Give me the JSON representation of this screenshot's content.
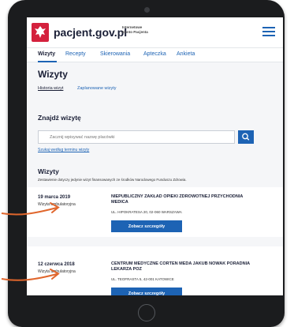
{
  "header": {
    "site_name": "pacjent.gov.pl",
    "sub_line1": "Internetowe",
    "sub_line2": "Konto Pacjenta"
  },
  "nav": {
    "tabs": [
      {
        "label": "Wizyty",
        "active": true
      },
      {
        "label": "Recepty"
      },
      {
        "label": "Skierowania"
      },
      {
        "label": "Apteczka"
      },
      {
        "label": "Ankieta"
      }
    ]
  },
  "main": {
    "title": "Wizyty",
    "subtabs": [
      "Historia wizyt",
      "Zaplanowane wizyty"
    ],
    "search": {
      "title": "Znajdź wizytę",
      "placeholder": "Zacznij wpisywać nazwę placówki",
      "advanced_link": "Szukaj według terminu wizyty"
    },
    "list": {
      "title": "Wizyty",
      "description": "Zestawienie dotyczy jedynie wizyt finansowanych ze środków Narodowego Funduszu Zdrowia."
    },
    "visits": [
      {
        "date": "19 marca 2019",
        "type": "Wizyta ambulatoryjna",
        "clinic": "NIEPUBLICZNY ZAKŁAD OPIEKI ZDROWOTNEJ PRZYCHODNIA MEDICA",
        "address": "UL. HIPOKRATESA 20, 02-060 WARSZAWA",
        "button": "Zobacz szczegóły"
      },
      {
        "date": "12 czerwca 2018",
        "type": "Wizyta ambulatoryjna",
        "clinic": "CENTRUM MEDYCZNE CORTEN MEDA JAKUB NOWAK PORADNIA LEKARZA POZ",
        "address": "UL. TEOFRASTA 5, 42-001 KATOWICE",
        "button": "Zobacz szczegóły"
      }
    ]
  },
  "colors": {
    "accent": "#1d63b4",
    "annotation_arrow": "#e0662c",
    "logo_red": "#d4213d"
  }
}
